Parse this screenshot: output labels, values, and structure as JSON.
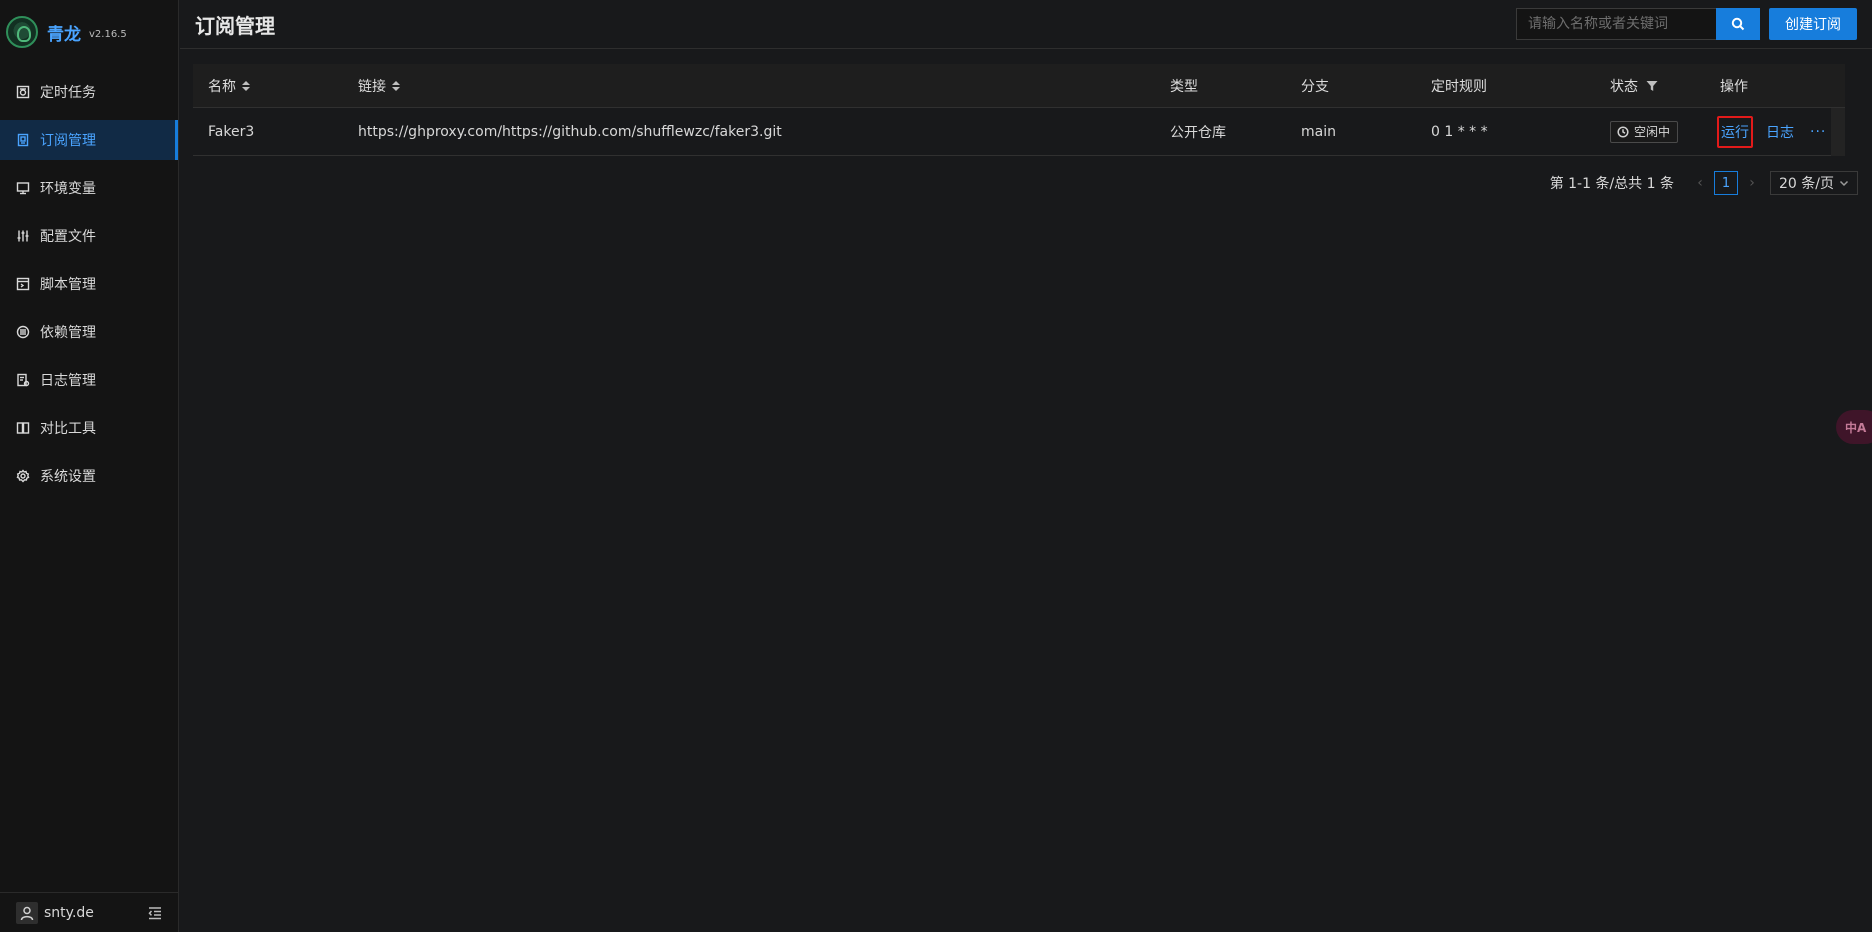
{
  "app": {
    "name": "青龙",
    "version": "v2.16.5"
  },
  "sidebar": {
    "items": [
      {
        "label": "定时任务",
        "active": false
      },
      {
        "label": "订阅管理",
        "active": true
      },
      {
        "label": "环境变量",
        "active": false
      },
      {
        "label": "配置文件",
        "active": false
      },
      {
        "label": "脚本管理",
        "active": false
      },
      {
        "label": "依赖管理",
        "active": false
      },
      {
        "label": "日志管理",
        "active": false
      },
      {
        "label": "对比工具",
        "active": false
      },
      {
        "label": "系统设置",
        "active": false
      }
    ],
    "footer": {
      "username": "snty.de"
    }
  },
  "header": {
    "title": "订阅管理",
    "search": {
      "placeholder": "请输入名称或者关键词",
      "value": ""
    },
    "create_label": "创建订阅"
  },
  "table": {
    "columns": [
      "名称",
      "链接",
      "类型",
      "分支",
      "定时规则",
      "状态",
      "操作"
    ],
    "rows": [
      {
        "name": "Faker3",
        "url": "https://ghproxy.com/https://github.com/shufflewzc/faker3.git",
        "type": "公开仓库",
        "branch": "main",
        "schedule": "0 1 * * *",
        "status": "空闲中",
        "actions": {
          "run": "运行",
          "log": "日志",
          "more": "···"
        }
      }
    ]
  },
  "pagination": {
    "summary": "第 1-1 条/总共 1 条",
    "current_page": "1",
    "page_size": "20 条/页"
  },
  "translate_fab": {
    "label": "中A"
  },
  "colors": {
    "accent": "#177ddc",
    "link": "#4aa4ff",
    "highlight": "#e21a1a"
  }
}
